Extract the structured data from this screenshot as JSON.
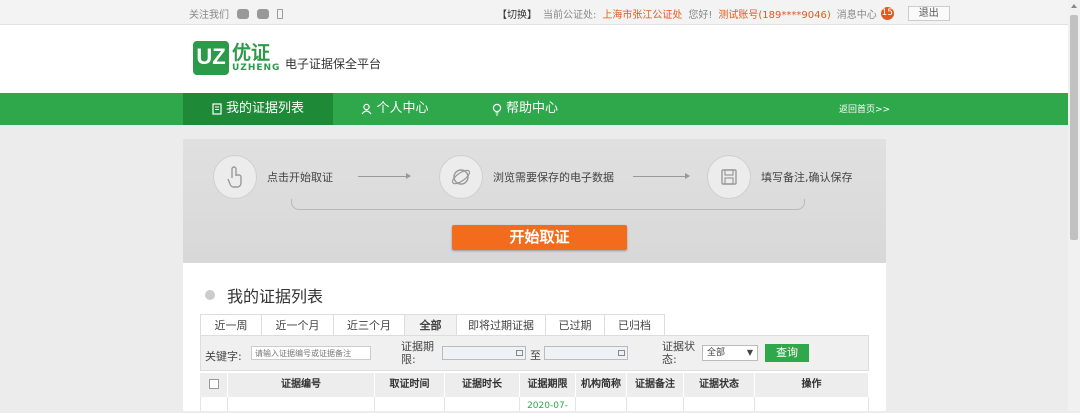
{
  "topbar": {
    "follow_label": "关注我们",
    "switch_label": "【切换】",
    "current_notary_label": "当前公证处:",
    "current_notary": "上海市张江公证处",
    "greeting": "您好!",
    "account": "测试账号(189****9046)",
    "messages_label": "消息中心",
    "messages_count": "15",
    "logout_label": "退出"
  },
  "header": {
    "logo_mark": "UZ",
    "logo_cn": "优证",
    "logo_en": "UZHENG",
    "platform_name": "电子证据保全平台"
  },
  "nav": {
    "items": [
      {
        "label": "我的证据列表",
        "icon": "document-icon"
      },
      {
        "label": "个人中心",
        "icon": "user-icon"
      },
      {
        "label": "帮助中心",
        "icon": "bulb-icon"
      }
    ],
    "back_home": "返回首页>>"
  },
  "steps": {
    "items": [
      {
        "label": "点击开始取证",
        "icon": "hand-pointer-icon"
      },
      {
        "label": "浏览需要保存的电子数据",
        "icon": "browser-icon"
      },
      {
        "label": "填写备注,确认保存",
        "icon": "save-icon"
      }
    ],
    "start_button": "开始取证"
  },
  "evidence": {
    "title": "我的证据列表",
    "tabs": [
      "近一周",
      "近一个月",
      "近三个月",
      "全部",
      "即将过期证据",
      "已过期",
      "已归档"
    ],
    "active_tab": "全部",
    "filter": {
      "keyword_label": "关键字:",
      "keyword_placeholder": "请输入证据编号或证据备注",
      "period_label": "证据期限:",
      "to_label": "至",
      "status_label": "证据状态:",
      "status_value": "全部",
      "query_label": "查询"
    },
    "columns": [
      "证据编号",
      "取证时间",
      "证据时长",
      "证据期限",
      "机构简称",
      "证据备注",
      "证据状态",
      "操作"
    ],
    "rows": [
      {
        "expiry": "2020-07-"
      }
    ]
  },
  "colors": {
    "green": "#2ea84b",
    "dark_green": "#1e8a37",
    "orange": "#f36b1c"
  }
}
